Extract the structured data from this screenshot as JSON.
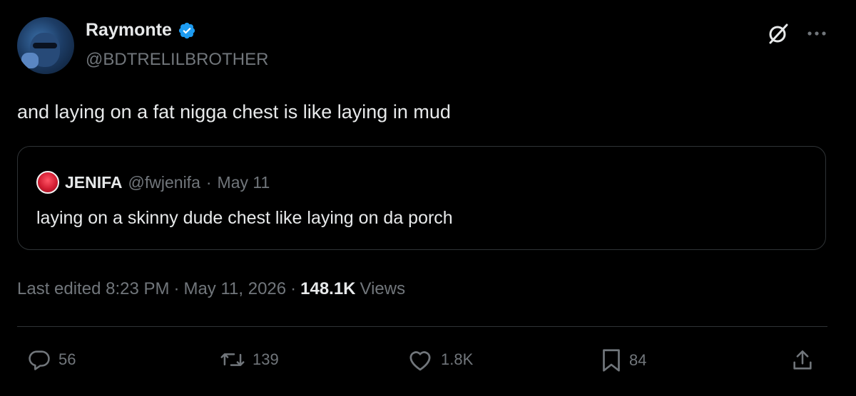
{
  "author": {
    "display_name": "Raymonte",
    "handle": "@BDTRELILBROTHER",
    "verified": true
  },
  "tweet": {
    "text": "and laying on a fat nigga chest is like laying in mud"
  },
  "quoted": {
    "name": "JENIFA",
    "handle": "@fwjenifa",
    "separator": "·",
    "date": "May 11",
    "text": "laying on a skinny dude chest like laying on da porch"
  },
  "meta": {
    "edited": "Last edited 8:23 PM",
    "separator": "·",
    "date": "May 11, 2026",
    "views_count": "148.1K",
    "views_label": "Views"
  },
  "actions": {
    "replies": "56",
    "reposts": "139",
    "likes": "1.8K",
    "bookmarks": "84"
  },
  "colors": {
    "background": "#000000",
    "text": "#e7e9ea",
    "muted": "#71767b",
    "border": "#2f3336",
    "verified": "#1d9bf0"
  },
  "icons": [
    "verified-badge-icon",
    "grok-icon",
    "more-icon",
    "reply-icon",
    "repost-icon",
    "like-icon",
    "bookmark-icon",
    "share-icon"
  ]
}
